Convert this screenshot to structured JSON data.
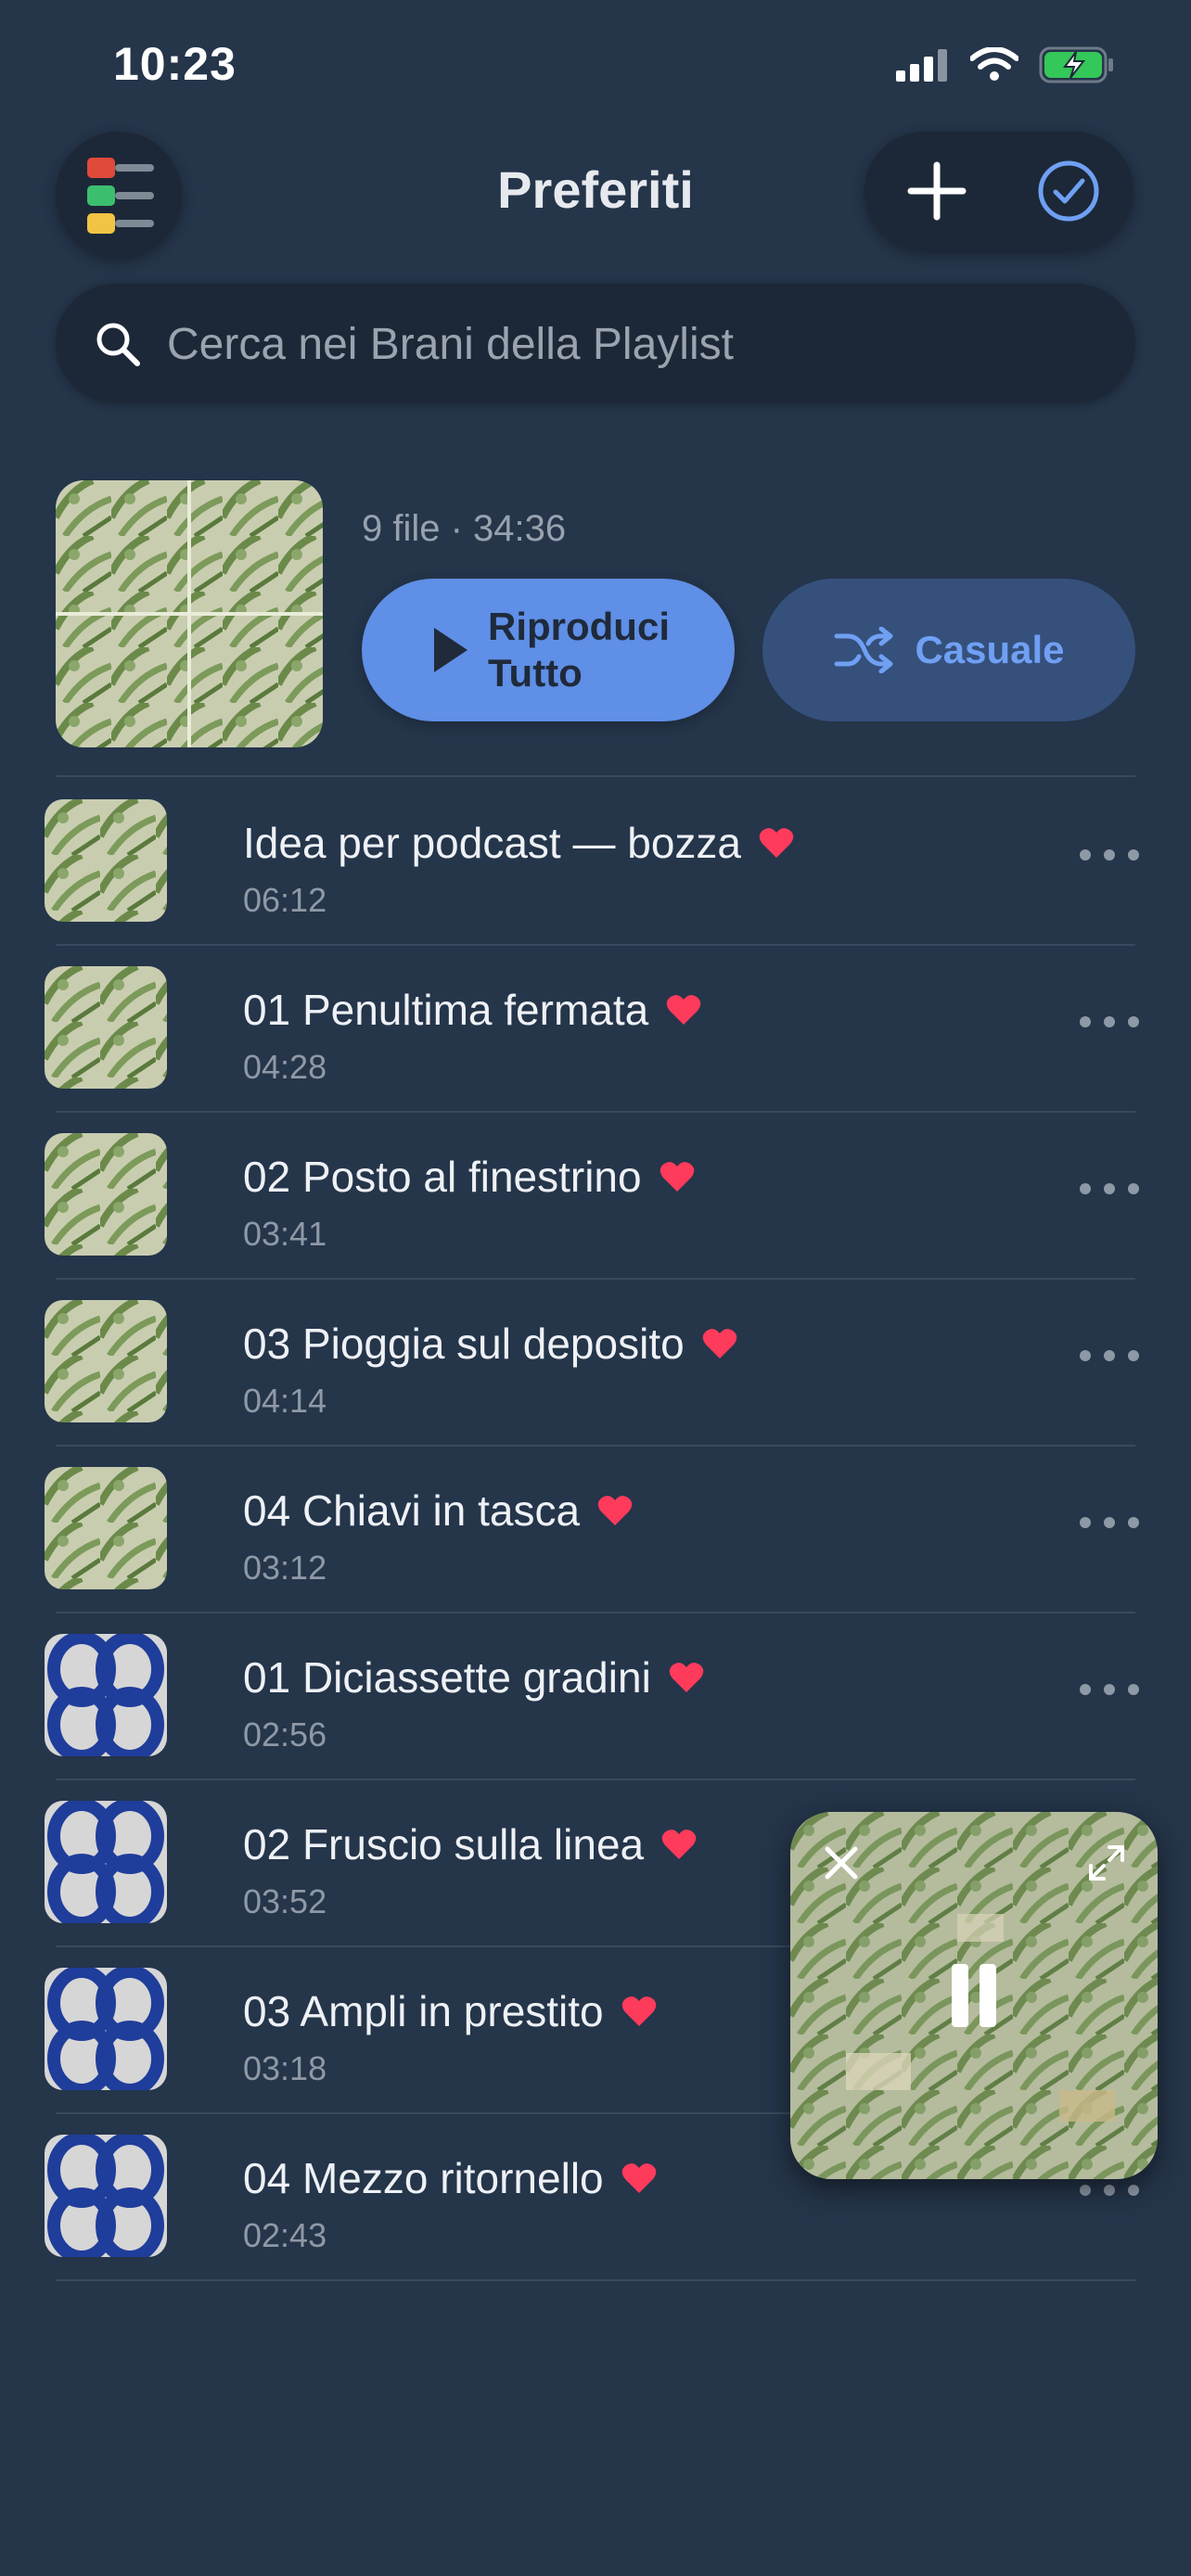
{
  "status_bar": {
    "time": "10:23"
  },
  "header": {
    "title": "Preferiti",
    "menu_icon": "playlists-menu-icon",
    "add_icon": "plus-icon",
    "select_icon": "checkmark-circle-icon"
  },
  "search": {
    "placeholder": "Cerca nei Brani della Playlist"
  },
  "playlist": {
    "meta": "9 file · 34:36",
    "play_all_label": "Riproduci Tutto",
    "shuffle_label": "Casuale"
  },
  "tracks": [
    {
      "title": "Idea per podcast — bozza",
      "duration": "06:12"
    },
    {
      "title": "01 Penultima fermata",
      "duration": "04:28"
    },
    {
      "title": "02 Posto al finestrino",
      "duration": "03:41"
    },
    {
      "title": "03 Pioggia sul deposito",
      "duration": "04:14"
    },
    {
      "title": "04 Chiavi in tasca",
      "duration": "03:12"
    },
    {
      "title": "01 Diciassette gradini",
      "duration": "02:56"
    },
    {
      "title": "02 Fruscio sulla linea",
      "duration": "03:52"
    },
    {
      "title": "03 Ampli in prestito",
      "duration": "03:18"
    },
    {
      "title": "04 Mezzo ritornello",
      "duration": "02:43"
    }
  ],
  "colors": {
    "background": "#25354a",
    "accent": "#5f8fe6",
    "heart": "#ff3b5c",
    "battery": "#34c759"
  }
}
